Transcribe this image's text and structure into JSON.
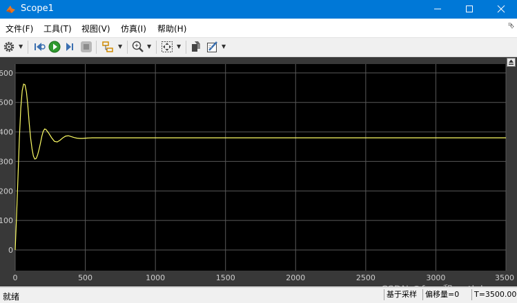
{
  "window": {
    "title": "Scope1"
  },
  "menu": {
    "items": [
      "文件(F)",
      "工具(T)",
      "视图(V)",
      "仿真(I)",
      "帮助(H)"
    ],
    "collapse_glyph": "⮷"
  },
  "toolbar": {
    "icons": [
      "gear-icon",
      "step-back-icon",
      "run-icon",
      "stop-icon",
      "highlight-icon",
      "zoom-icon",
      "fit-icon",
      "cursor-icon",
      "style-icon"
    ]
  },
  "statusbar": {
    "ready": "就绪",
    "sample": "基于采样",
    "offset": "偏移量=0",
    "time": "T=3500.000"
  },
  "watermark": "CSDN @fpga和matlab",
  "colors": {
    "background": "#000000",
    "grid": "#5a5a5a",
    "line": "#ffff66",
    "tick_text": "#d0d0d0",
    "frame": "#383838"
  },
  "chart_data": {
    "type": "line",
    "title": "",
    "xlabel": "",
    "ylabel": "",
    "xlim": [
      0,
      3500
    ],
    "ylim": [
      -70,
      630
    ],
    "xticks": [
      0,
      500,
      1000,
      1500,
      2000,
      2500,
      3000,
      3500
    ],
    "yticks": [
      0,
      100,
      200,
      300,
      400,
      500,
      600
    ],
    "grid": true,
    "series": [
      {
        "x": [
          0,
          10,
          20,
          30,
          40,
          50,
          60,
          70,
          80,
          90,
          100,
          110,
          120,
          130,
          140,
          150,
          160,
          170,
          180,
          190,
          200,
          210,
          220,
          240,
          260,
          280,
          300,
          320,
          340,
          360,
          380,
          400,
          420,
          440,
          460,
          480,
          500,
          550,
          600,
          650,
          700,
          800,
          1000,
          1500,
          2000,
          2500,
          3000,
          3500
        ],
        "y": [
          0,
          115,
          250,
          380,
          480,
          540,
          562,
          560,
          535,
          490,
          430,
          380,
          343,
          318,
          308,
          310,
          322,
          340,
          362,
          385,
          402,
          410,
          408,
          395,
          380,
          368,
          366,
          372,
          380,
          386,
          387,
          384,
          381,
          379,
          378,
          378,
          379,
          380,
          380,
          380,
          380,
          380,
          380,
          380,
          380,
          380,
          380,
          380
        ]
      }
    ]
  }
}
